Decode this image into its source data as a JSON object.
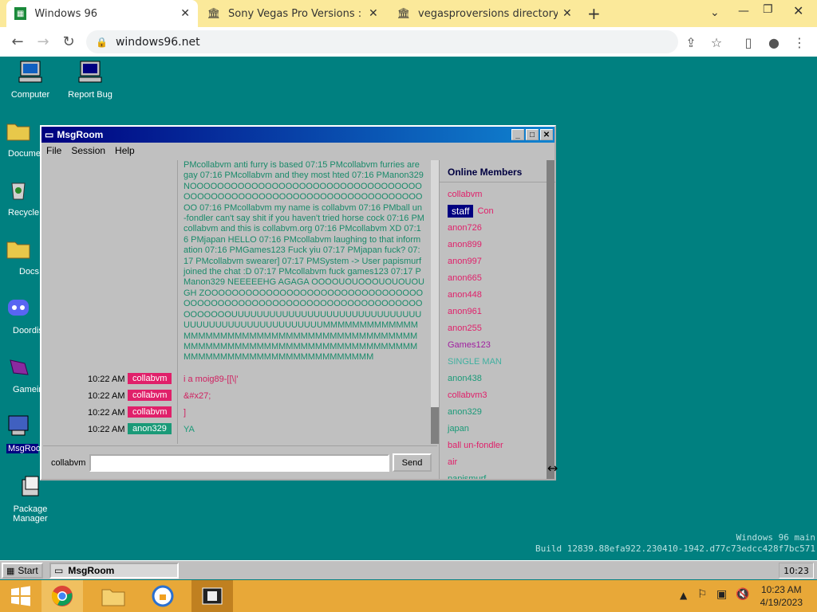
{
  "browser": {
    "tabs": [
      {
        "title": "Windows 96",
        "active": true
      },
      {
        "title": "Sony Vegas Pro Versions : Free D"
      },
      {
        "title": "vegasproversions directory listin"
      }
    ],
    "url": "windows96.net"
  },
  "desktop": {
    "icons": [
      {
        "label": "Computer"
      },
      {
        "label": "Report Bug"
      },
      {
        "label": "Docume"
      },
      {
        "label": "Recycle"
      },
      {
        "label": "Docs"
      },
      {
        "label": "Doordis"
      },
      {
        "label": "Gamein"
      },
      {
        "label": "MsgRoo"
      },
      {
        "label": "Package Manager"
      }
    ]
  },
  "window": {
    "title": "MsgRoom",
    "menu": [
      "File",
      "Session",
      "Help"
    ],
    "big_message": "PMcollabvm anti furry is based 07:15 PMcollabvm furries are gay 07:16 PMcollabvm and they most hted 07:16 PManon329 NOOOOOOOOOOOOOOOOOOOOOOOOOOOOOOOOOOOOOOOOOOOOOOOOOOOOOOOOOOOOOOOOOOOOOOO 07:16 PMcollabvm my name is collabvm 07:16 PMball un-fondler can't say shit if you haven't tried horse cock 07:16 PMcollabvm and this is collabvm.org 07:16 PMcollabvm XD 07:16 PMjapan HELLO 07:16 PMcollabvm laughing to that information 07:16 PMGames123 Fuck yiu 07:17 PMjapan fuck? 07:17 PMcollabvm swearer] 07:17 PMSystem -> User papismurf joined the chat :D 07:17 PMcollabvm fuck games123 07:17 PManon329 NEEEEEHG AGAGA OOOOUOUOOOUOUOUOUGH ZOOOOOOOOOOOOOOOOOOOOOOOOOOOOOOOOOOOOOOOOOOOOOOOOOOOOOOOOOOOOOOOOOOOOOOOOOOUUUUUUUUUUUUUUUUUUUUUUUUUUUUUUUUUUUUUUUUUUUUUUUUUUUUMMMMMMMMMMMMMMMMMMMMMMMMMMMMMMMMMMMMMMMMMMMMMMMMMMMMMMMMMMMMMMMMMMMMMMMMMMMMMMMMMMMMMMMMMMMMMMMMMMMMMMM",
    "messages": [
      {
        "time": "10:22 AM",
        "nick": "collabvm",
        "nick_color": "#e0206a",
        "text": "i a moig89-[[\\|'",
        "text_color": "#d02060"
      },
      {
        "time": "10:22 AM",
        "nick": "collabvm",
        "nick_color": "#e0206a",
        "text": "&#x27;",
        "text_color": "#d02060"
      },
      {
        "time": "10:22 AM",
        "nick": "collabvm",
        "nick_color": "#e0206a",
        "text": "]",
        "text_color": "#d02060"
      },
      {
        "time": "10:22 AM",
        "nick": "anon329",
        "nick_color": "#1a9a78",
        "text": "YA",
        "text_color": "#1a9a78"
      }
    ],
    "members_header": "Online Members",
    "members": [
      {
        "name": "collabvm",
        "color": "#e0206a"
      },
      {
        "name": "Con",
        "color": "#e0206a",
        "badge": "staff"
      },
      {
        "name": "anon726",
        "color": "#e0206a"
      },
      {
        "name": "anon899",
        "color": "#e0206a"
      },
      {
        "name": "anon997",
        "color": "#e0206a"
      },
      {
        "name": "anon665",
        "color": "#e0206a"
      },
      {
        "name": "anon448",
        "color": "#e0206a"
      },
      {
        "name": "anon961",
        "color": "#e0206a"
      },
      {
        "name": "anon255",
        "color": "#e0206a"
      },
      {
        "name": "Games123",
        "color": "#a020a0"
      },
      {
        "name": "SINGLE MAN",
        "color": "#40b0a0"
      },
      {
        "name": "anon438",
        "color": "#1a9a78"
      },
      {
        "name": "collabvm3",
        "color": "#e0206a"
      },
      {
        "name": "anon329",
        "color": "#1a9a78"
      },
      {
        "name": "japan",
        "color": "#1a9a78"
      },
      {
        "name": "ball un-fondler",
        "color": "#e0206a"
      },
      {
        "name": "air",
        "color": "#e0206a"
      },
      {
        "name": "papismurf",
        "color": "#1a9a78"
      }
    ],
    "input_label": "collabvm",
    "input_value": "",
    "send_label": "Send"
  },
  "build": {
    "line1": "Windows 96 main",
    "line2": "Build 12839.88efa922.230410-1942.d77c73edcc428f7bc571"
  },
  "w96_taskbar": {
    "start_label": "Start",
    "task_label": "MsgRoom",
    "clock": "10:23"
  },
  "system": {
    "time": "10:23 AM",
    "date": "4/19/2023"
  }
}
